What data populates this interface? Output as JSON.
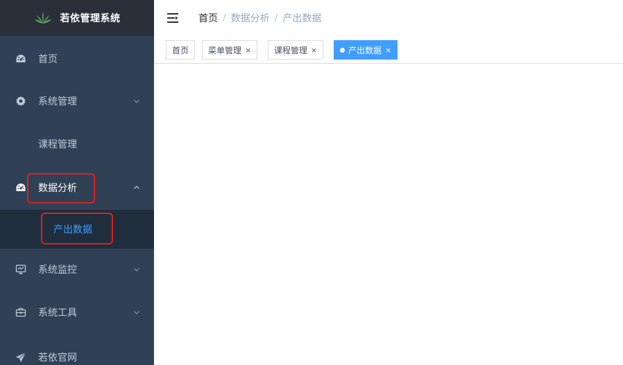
{
  "app": {
    "title": "若依管理系统"
  },
  "sidebar": {
    "items": [
      {
        "label": "首页",
        "icon": "dashboard-icon"
      },
      {
        "label": "系统管理",
        "icon": "gear-icon",
        "arrow": "chevron-down-icon"
      },
      {
        "label": "课程管理"
      },
      {
        "label": "数据分析",
        "icon": "dashboard-icon",
        "arrow": "chevron-up-icon"
      },
      {
        "label": "产出数据"
      },
      {
        "label": "系统监控",
        "icon": "monitor-icon",
        "arrow": "chevron-down-icon"
      },
      {
        "label": "系统工具",
        "icon": "toolbox-icon",
        "arrow": "chevron-down-icon"
      },
      {
        "label": "若依官网",
        "icon": "send-icon"
      }
    ]
  },
  "breadcrumb": {
    "items": [
      "首页",
      "数据分析",
      "产出数据"
    ],
    "separator": "/"
  },
  "tags": [
    {
      "label": "首页",
      "closable": false,
      "active": false
    },
    {
      "label": "菜单管理",
      "closable": true,
      "active": false
    },
    {
      "label": "课程管理",
      "closable": true,
      "active": false
    },
    {
      "label": "产出数据",
      "closable": true,
      "active": true
    }
  ],
  "close_glyph": "×",
  "colors": {
    "sidebar_bg": "#304156",
    "submenu_bg": "#1f2d3d",
    "menu_text": "#bfcbd9",
    "accent": "#409eff",
    "highlight_box": "#e02020"
  }
}
